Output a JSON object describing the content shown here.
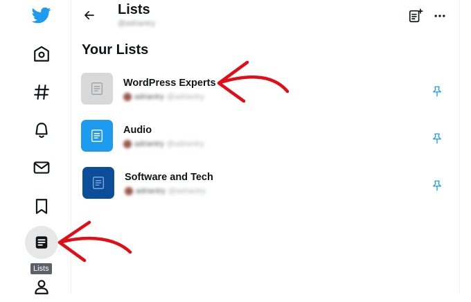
{
  "sidebar": {
    "items": [
      {
        "name": "twitter-logo-icon"
      },
      {
        "name": "home-icon"
      },
      {
        "name": "explore-hashtag-icon"
      },
      {
        "name": "notifications-bell-icon"
      },
      {
        "name": "messages-mail-icon"
      },
      {
        "name": "bookmarks-icon"
      },
      {
        "name": "lists-icon"
      },
      {
        "name": "profile-icon"
      }
    ],
    "tooltip": "Lists",
    "brand_color": "#1d9bf0"
  },
  "header": {
    "title": "Lists",
    "subtitle": "@adriantry"
  },
  "section_title": "Your Lists",
  "lists": [
    {
      "name": "WordPress Experts",
      "owner": "adriantry",
      "handle": "@adriantry",
      "thumb_color": "#d9d9d9"
    },
    {
      "name": "Audio",
      "owner": "adriantry",
      "handle": "@adriantry",
      "thumb_color": "#1d9bf0"
    },
    {
      "name": "Software and Tech",
      "owner": "adriantry",
      "handle": "@adriantry",
      "thumb_color": "#0b4d99"
    }
  ],
  "colors": {
    "accent": "#1d9bf0",
    "annotation": "#e30d17"
  }
}
